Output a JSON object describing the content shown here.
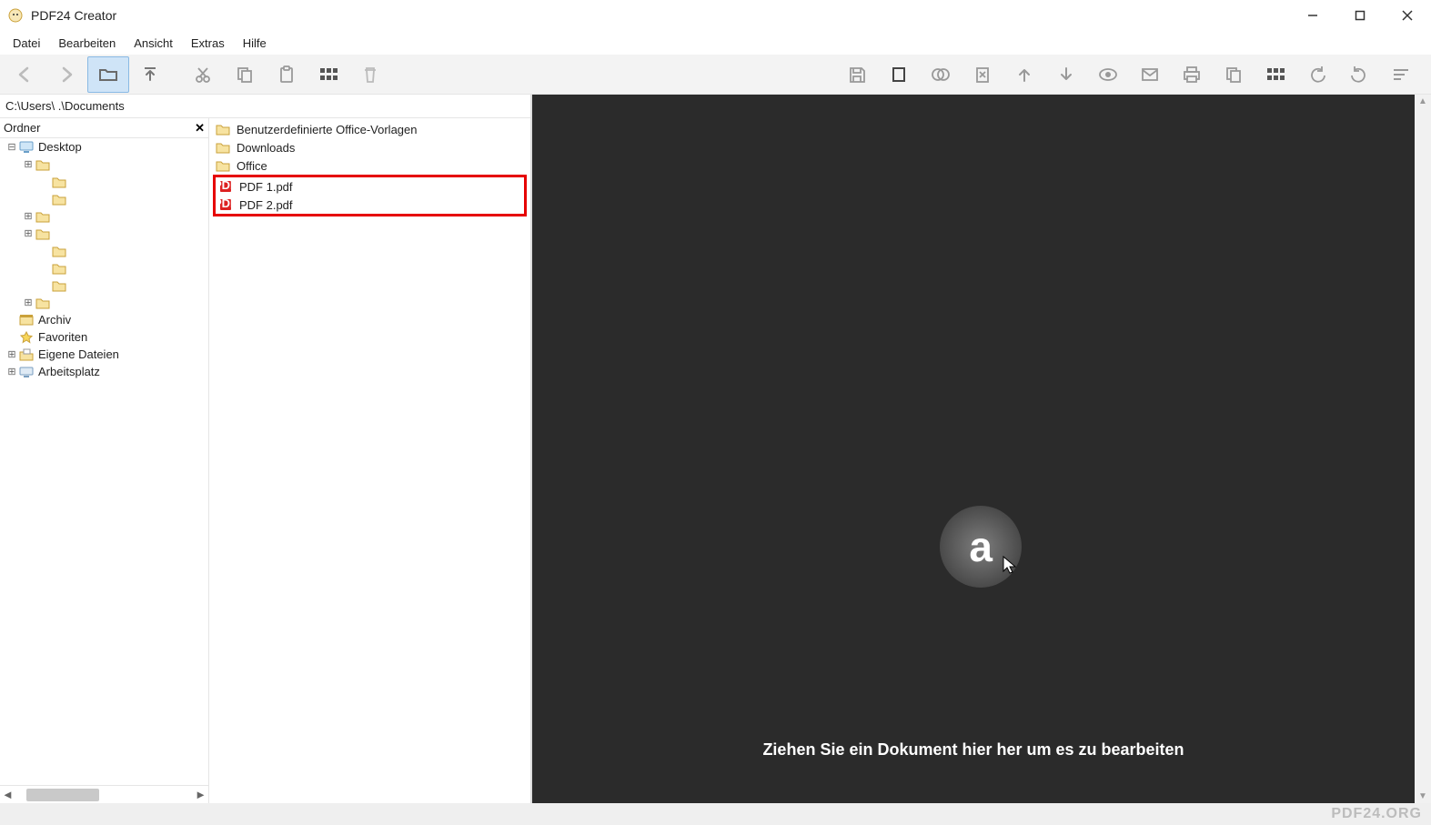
{
  "window": {
    "title": "PDF24 Creator"
  },
  "menu": {
    "items": [
      "Datei",
      "Bearbeiten",
      "Ansicht",
      "Extras",
      "Hilfe"
    ]
  },
  "left_toolbar": {
    "back": "back-icon",
    "forward": "forward-icon",
    "browse": "folder-open-icon",
    "up": "up-arrow-icon",
    "cut": "scissors-icon",
    "copy": "copy-icon",
    "paste": "clipboard-icon",
    "grid": "grid-icon",
    "delete": "trash-icon"
  },
  "right_toolbar": {
    "save": "save-icon",
    "page": "page-icon",
    "merge": "merge-icon",
    "remove": "remove-page-icon",
    "moveup": "arrow-up-icon",
    "movedown": "arrow-down-icon",
    "preview": "eye-icon",
    "mail": "mail-icon",
    "print": "print-icon",
    "export": "export-icon",
    "thumbs": "thumbnails-icon",
    "rotate_left": "rotate-left-icon",
    "rotate_right": "rotate-right-icon",
    "sort": "sort-icon"
  },
  "path": "C:\\Users\\     .\\Documents",
  "tree": {
    "header": "Ordner",
    "nodes": [
      {
        "level": 0,
        "exp": "−",
        "icon": "desktop",
        "name": "Desktop"
      },
      {
        "level": 1,
        "exp": "+",
        "icon": "folder",
        "name": ""
      },
      {
        "level": 2,
        "exp": " ",
        "icon": "folder",
        "name": ""
      },
      {
        "level": 2,
        "exp": " ",
        "icon": "folder",
        "name": ""
      },
      {
        "level": 1,
        "exp": "+",
        "icon": "folder",
        "name": ""
      },
      {
        "level": 1,
        "exp": "+",
        "icon": "folder",
        "name": ""
      },
      {
        "level": 2,
        "exp": " ",
        "icon": "folder",
        "name": ""
      },
      {
        "level": 2,
        "exp": " ",
        "icon": "folder",
        "name": ""
      },
      {
        "level": 2,
        "exp": " ",
        "icon": "folder",
        "name": ""
      },
      {
        "level": 1,
        "exp": "+",
        "icon": "folder",
        "name": ""
      },
      {
        "level": 0,
        "exp": " ",
        "icon": "archive",
        "name": "Archiv"
      },
      {
        "level": 0,
        "exp": " ",
        "icon": "favorites",
        "name": "Favoriten"
      },
      {
        "level": 0,
        "exp": "+",
        "icon": "mydocs",
        "name": "Eigene Dateien"
      },
      {
        "level": 0,
        "exp": "+",
        "icon": "computer",
        "name": "Arbeitsplatz"
      }
    ]
  },
  "files": {
    "folders": [
      "Benutzerdefinierte Office-Vorlagen",
      "Downloads",
      "Office"
    ],
    "highlighted_pdfs": [
      "PDF 1.pdf",
      "PDF 2.pdf"
    ]
  },
  "preview": {
    "drop_hint": "Ziehen Sie ein Dokument hier her um es zu bearbeiten",
    "logo_text": "a"
  },
  "footer": {
    "brand": "PDF24.ORG"
  }
}
